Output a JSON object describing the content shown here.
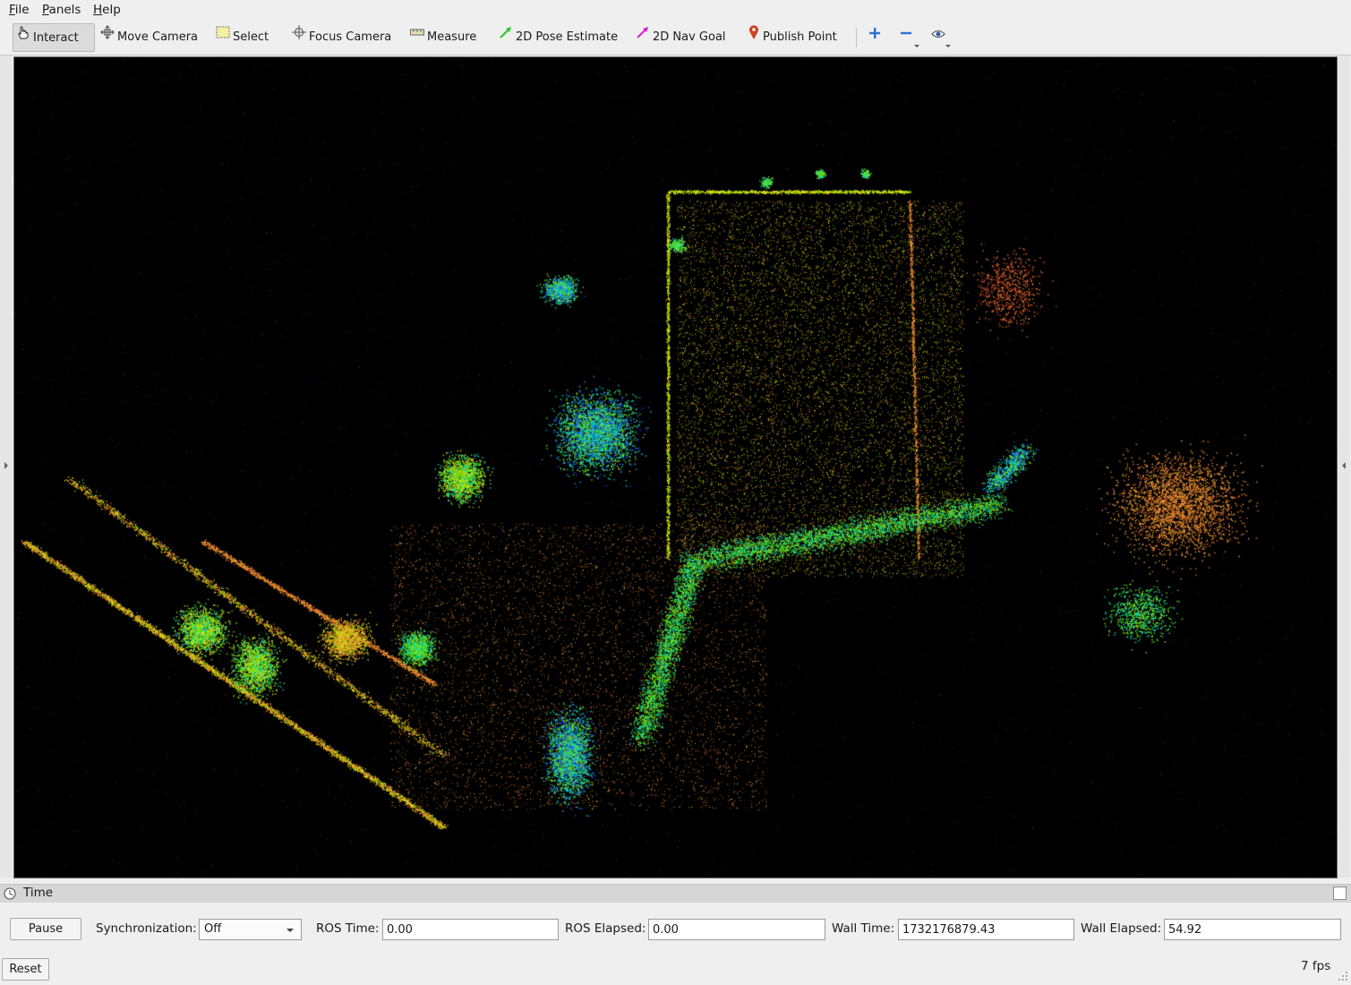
{
  "menubar": {
    "items": [
      {
        "label": "File",
        "mnemonic": "F",
        "rest": "ile"
      },
      {
        "label": "Panels",
        "mnemonic": "P",
        "rest": "anels"
      },
      {
        "label": "Help",
        "mnemonic": "H",
        "rest": "elp"
      }
    ]
  },
  "toolbar": {
    "tools": [
      {
        "label": "Interact",
        "icon": "hand-pointer-icon",
        "active": true
      },
      {
        "label": "Move Camera",
        "icon": "move-arrows-icon",
        "active": false
      },
      {
        "label": "Select",
        "icon": "select-rectangle-icon",
        "active": false
      },
      {
        "label": "Focus Camera",
        "icon": "crosshair-icon",
        "active": false
      },
      {
        "label": "Measure",
        "icon": "ruler-icon",
        "active": false
      },
      {
        "label": "2D Pose Estimate",
        "icon": "green-arrow-icon",
        "active": false
      },
      {
        "label": "2D Nav Goal",
        "icon": "magenta-arrow-icon",
        "active": false
      },
      {
        "label": "Publish Point",
        "icon": "map-pin-icon",
        "active": false
      }
    ],
    "extra_icons": [
      "add-tool-icon",
      "remove-tool-icon",
      "view-eye-icon"
    ]
  },
  "colors": {
    "viewport_bg": "#000000",
    "point_cloud_palette": [
      "#2040ff",
      "#10a0ff",
      "#10e0c0",
      "#30e030",
      "#a0e000",
      "#f0e020",
      "#f0a030",
      "#e07030",
      "#c04020"
    ],
    "pose_arrow": "#22cc22",
    "goal_arrow": "#dd22cc",
    "pin": "#d04020",
    "plus_minus": "#2a6fd0"
  },
  "time_panel": {
    "title": "Time",
    "pause_label": "Pause",
    "sync_label": "Synchronization:",
    "sync_value": "Off",
    "ros_time_label": "ROS Time:",
    "ros_time_value": "0.00",
    "ros_elapsed_label": "ROS Elapsed:",
    "ros_elapsed_value": "0.00",
    "wall_time_label": "Wall Time:",
    "wall_time_value": "1732176879.43",
    "wall_elapsed_label": "Wall Elapsed:",
    "wall_elapsed_value": "54.92"
  },
  "footer": {
    "reset_label": "Reset",
    "fps": "7 fps"
  }
}
